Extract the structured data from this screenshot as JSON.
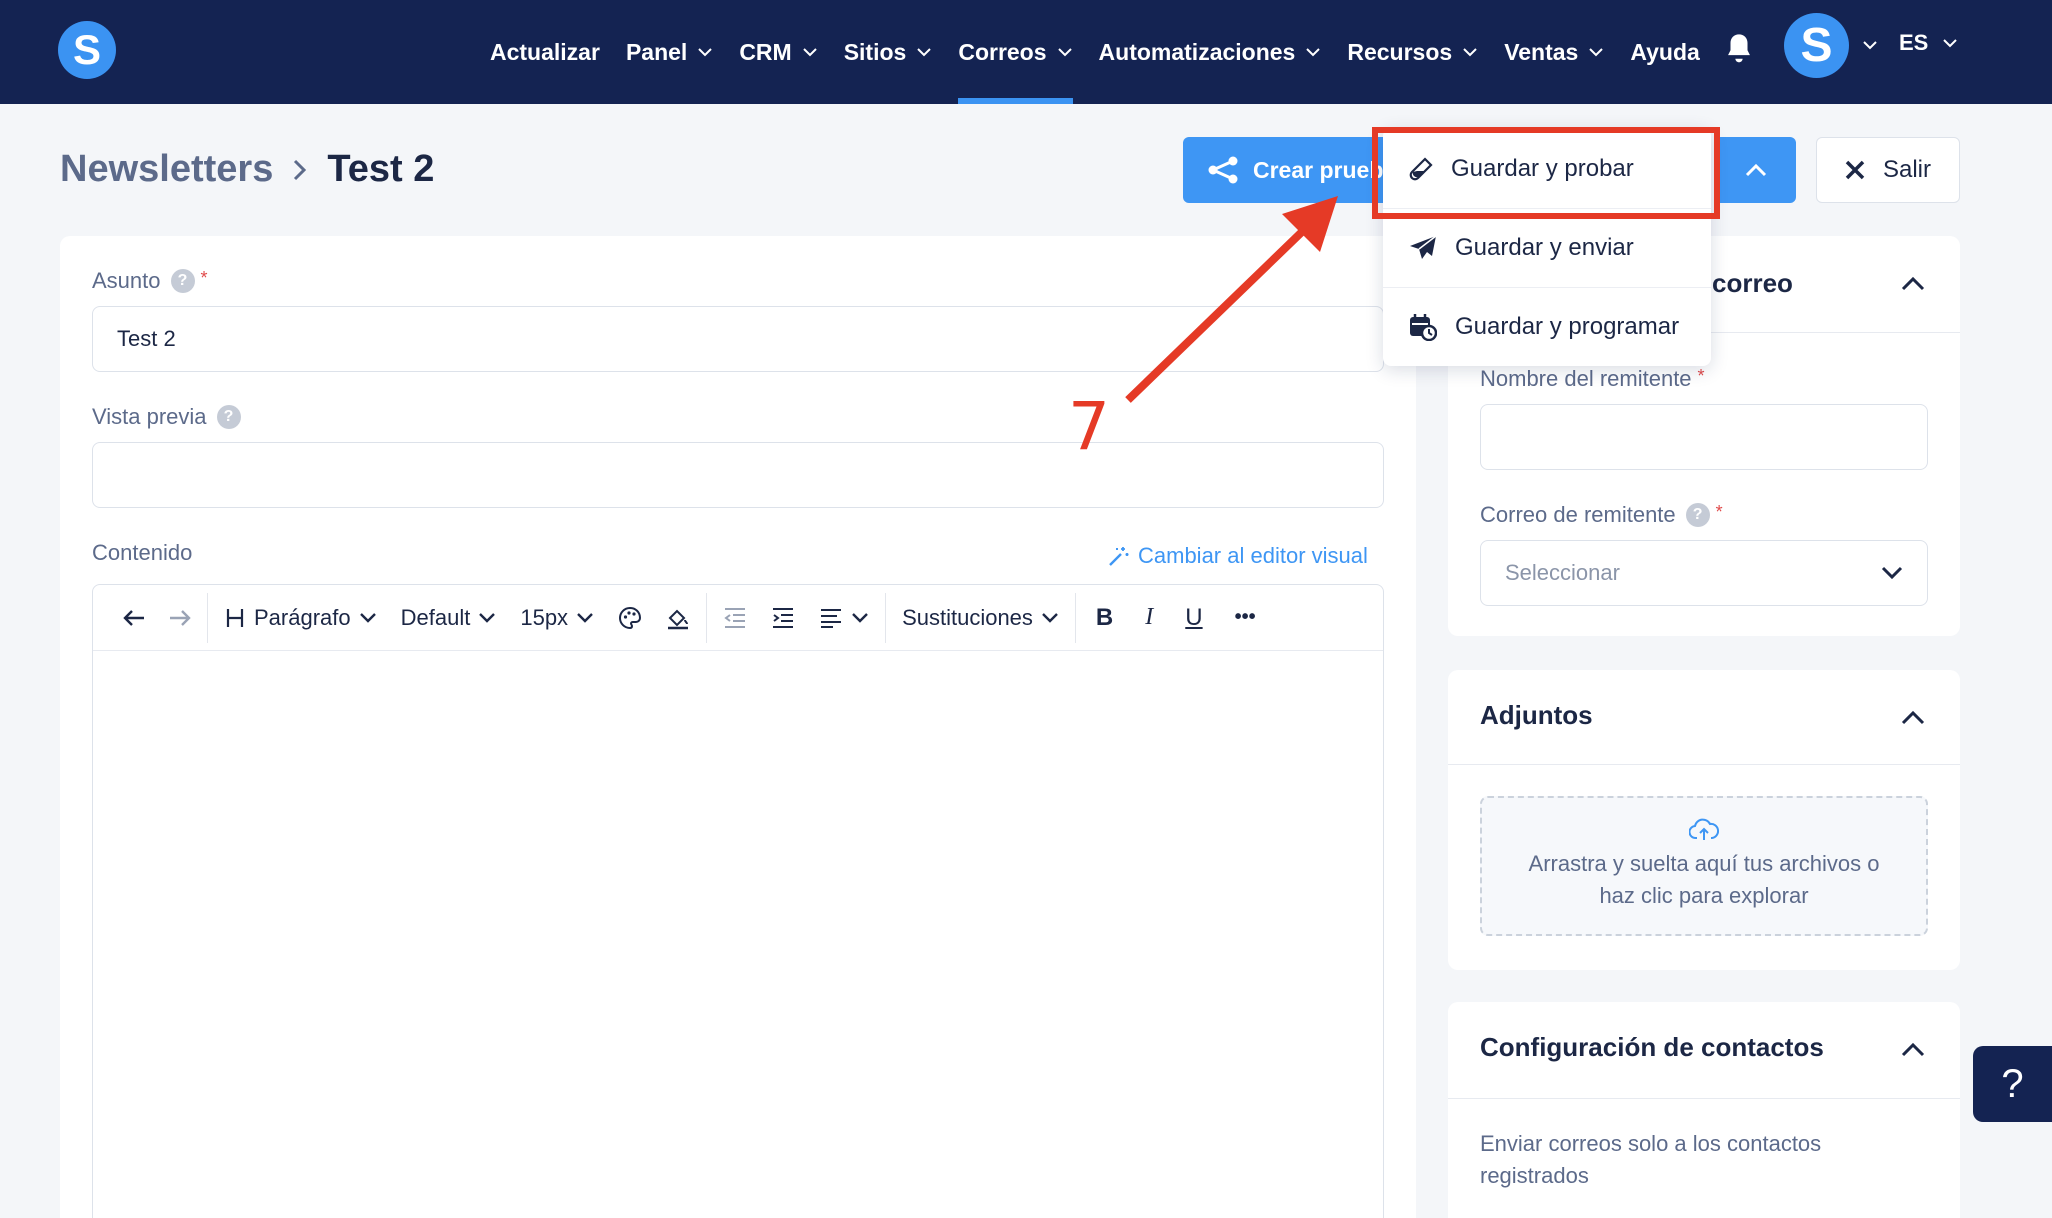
{
  "app": {
    "logo_letter": "S",
    "avatar_letter": "S",
    "language": "ES"
  },
  "nav": {
    "items": [
      {
        "label": "Actualizar",
        "has_dropdown": false,
        "active": false
      },
      {
        "label": "Panel",
        "has_dropdown": true,
        "active": false
      },
      {
        "label": "CRM",
        "has_dropdown": true,
        "active": false
      },
      {
        "label": "Sitios",
        "has_dropdown": true,
        "active": false
      },
      {
        "label": "Correos",
        "has_dropdown": true,
        "active": true
      },
      {
        "label": "Automatizaciones",
        "has_dropdown": true,
        "active": false
      },
      {
        "label": "Recursos",
        "has_dropdown": true,
        "active": false
      },
      {
        "label": "Ventas",
        "has_dropdown": true,
        "active": false
      },
      {
        "label": "Ayuda",
        "has_dropdown": false,
        "active": false
      }
    ]
  },
  "breadcrumb": {
    "root": "Newsletters",
    "current": "Test 2"
  },
  "actions": {
    "create_label": "Crear prueba",
    "exit_label": "Salir"
  },
  "dropdown": {
    "items": [
      {
        "label": "Guardar y probar",
        "icon": "test-tube-icon"
      },
      {
        "label": "Guardar y enviar",
        "icon": "paper-plane-icon"
      },
      {
        "label": "Guardar y programar",
        "icon": "calendar-clock-icon"
      }
    ]
  },
  "form": {
    "subject_label": "Asunto",
    "subject_value": "Test 2",
    "preview_label": "Vista previa",
    "preview_value": "",
    "content_label": "Contenido",
    "switch_editor": "Cambiar al editor visual"
  },
  "toolbar": {
    "heading": "Parágrafo",
    "font": "Default",
    "size": "15px",
    "substitutions": "Sustituciones",
    "bold": "B",
    "italic": "I",
    "underline": "U",
    "more": "•••"
  },
  "sender_card": {
    "title_fragment": "correo",
    "name_label": "Nombre del remitente",
    "name_value": "",
    "email_label": "Correo de remitente",
    "email_placeholder": "Seleccionar"
  },
  "attachments_card": {
    "title": "Adjuntos",
    "dropzone_line1": "Arrastra y suelta aquí tus archivos o",
    "dropzone_line2": "haz clic para explorar"
  },
  "contacts_card": {
    "title": "Configuración de contactos",
    "text_line1": "Enviar correos solo a los contactos",
    "text_line2": "registrados"
  },
  "annotation": {
    "step_number": "7",
    "color": "#e53a26"
  },
  "colors": {
    "nav_bg": "#142352",
    "accent": "#3e96f4",
    "required": "#e04a4a"
  },
  "help_float": "?"
}
